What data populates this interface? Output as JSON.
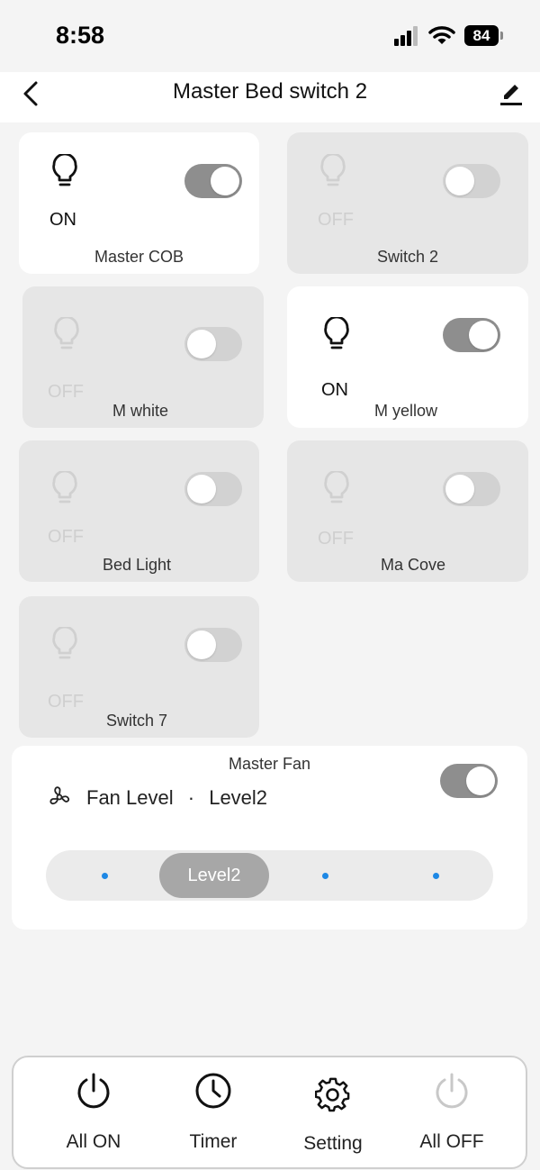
{
  "status_bar": {
    "time": "8:58",
    "battery": "84"
  },
  "header": {
    "title": "Master Bed switch 2"
  },
  "switches": [
    {
      "name": "Master COB",
      "state": "ON"
    },
    {
      "name": "Switch 2",
      "state": "OFF"
    },
    {
      "name": "M white",
      "state": "OFF"
    },
    {
      "name": "M yellow",
      "state": "ON"
    },
    {
      "name": "Bed Light",
      "state": "OFF"
    },
    {
      "name": "Ma Cove",
      "state": "OFF"
    },
    {
      "name": "Switch 7",
      "state": "OFF"
    }
  ],
  "fan": {
    "title": "Master Fan",
    "level_label": "Fan Level",
    "separator": "·",
    "level_value": "Level2",
    "selected_level": "Level2",
    "power": "on"
  },
  "bottom_bar": {
    "all_on": "All ON",
    "timer": "Timer",
    "setting": "Setting",
    "all_off": "All OFF"
  },
  "colors": {
    "dot_accent": "#1e88e5",
    "toggle_on": "#8e8e8e",
    "toggle_off": "#d2d2d2",
    "card_off": "#e6e6e6"
  }
}
